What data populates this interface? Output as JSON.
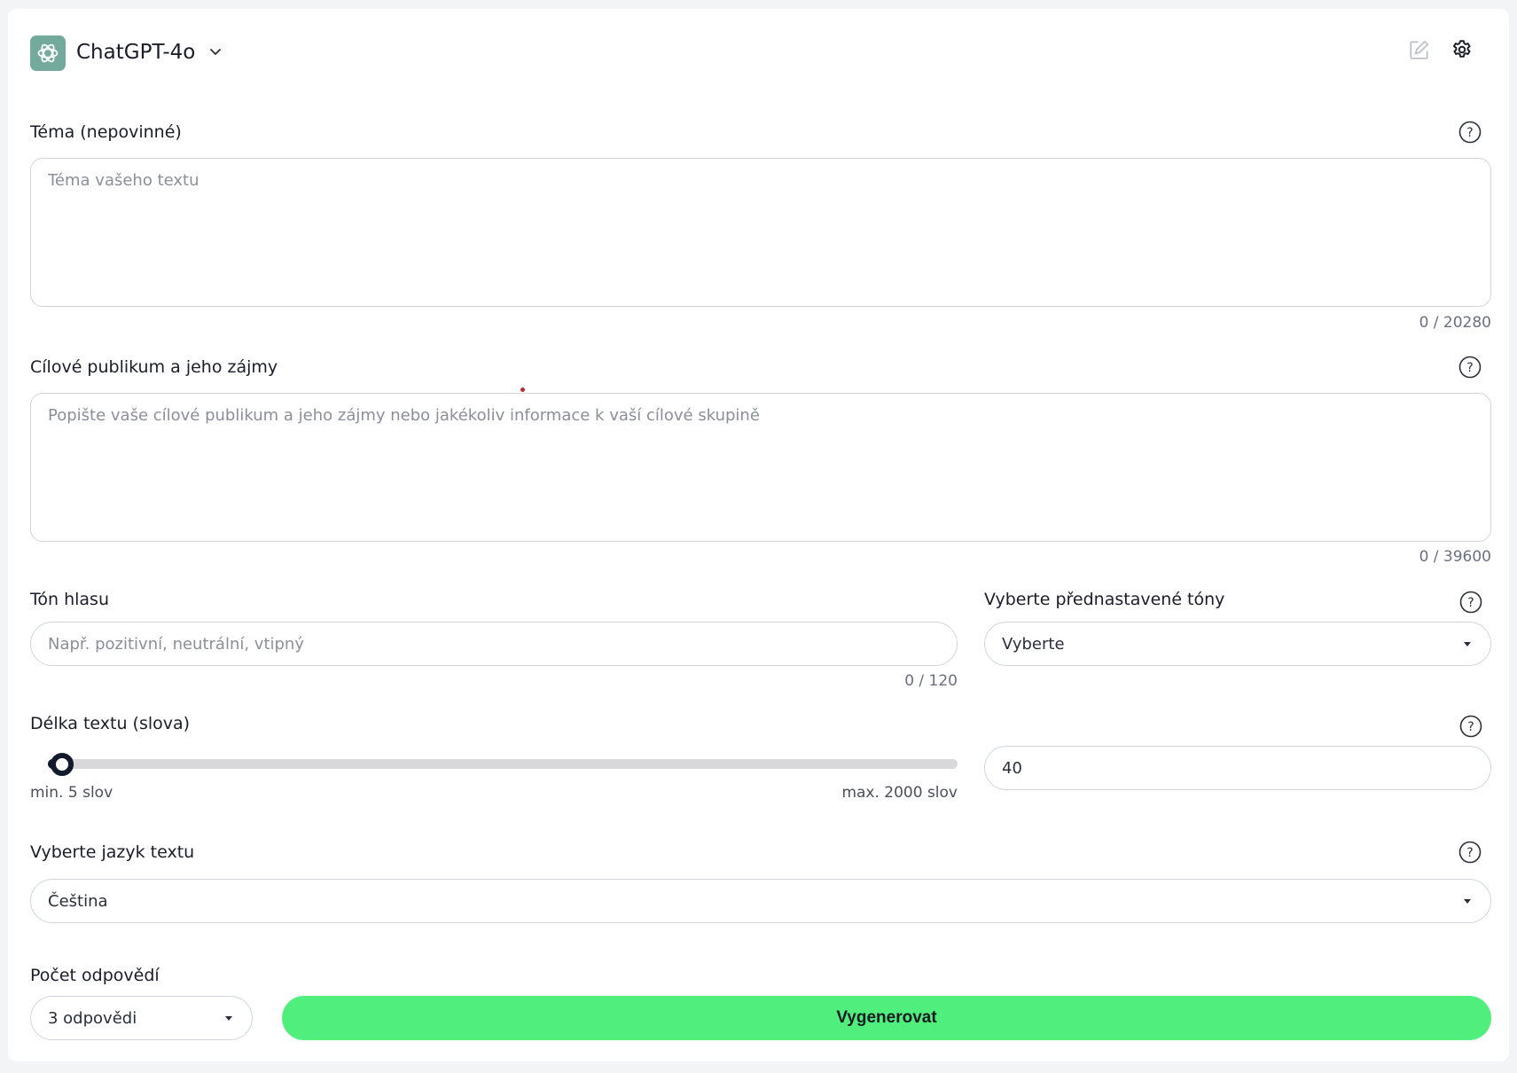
{
  "header": {
    "model_name": "ChatGPT-4o",
    "model_icon": "openai-logo-icon",
    "edit_icon": "edit-icon",
    "settings_icon": "gear-icon"
  },
  "topic": {
    "label": "Téma (nepovinné)",
    "placeholder": "Téma vašeho textu",
    "counter": "0 / 20280"
  },
  "audience": {
    "label": "Cílové publikum a jeho zájmy",
    "placeholder": "Popište vaše cílové publikum a jeho zájmy nebo jakékoliv informace k vaší cílové skupině",
    "counter": "0 / 39600"
  },
  "tone": {
    "label": "Tón hlasu",
    "placeholder": "Např. pozitivní, neutrální, vtipný",
    "counter": "0 / 120"
  },
  "preset_tones": {
    "label": "Vyberte přednastavené tóny",
    "selected": "Vyberte"
  },
  "length": {
    "label": "Délka textu (slova)",
    "min_label": "min. 5 slov",
    "max_label": "max. 2000 slov",
    "min": 5,
    "max": 2000,
    "value": "40"
  },
  "language": {
    "label": "Vyberte jazyk textu",
    "selected": "Čeština"
  },
  "responses": {
    "label": "Počet odpovědí",
    "selected": "3 odpovědi"
  },
  "generate_label": "Vygenerovat",
  "colors": {
    "accent_green": "#50ee7d",
    "model_icon_bg": "#74aa9c",
    "slider_dark": "#141a2e"
  }
}
